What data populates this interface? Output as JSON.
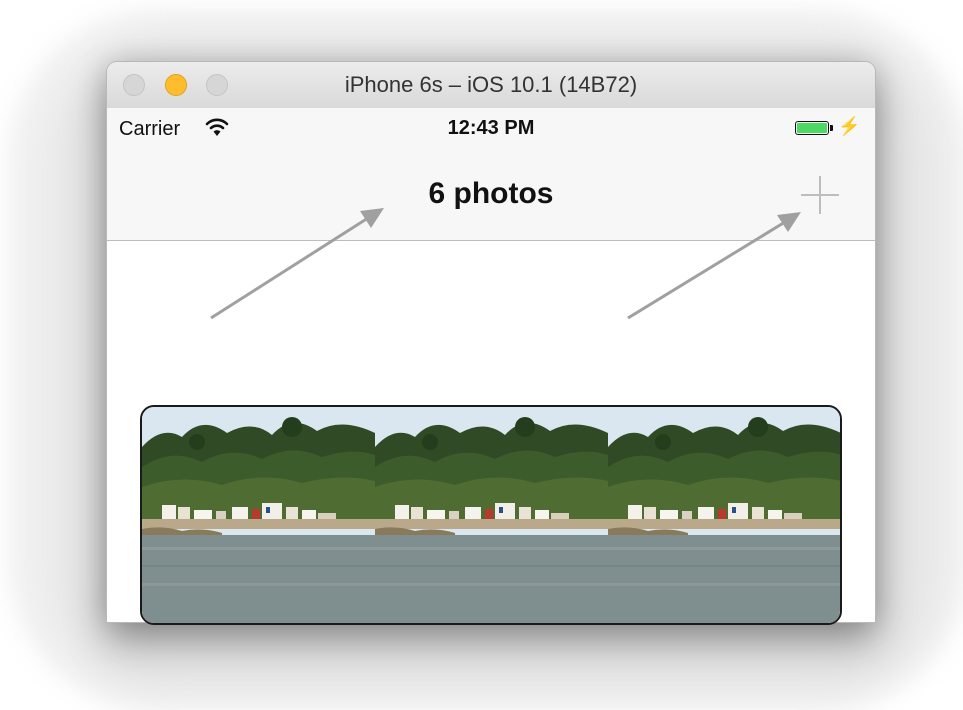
{
  "window": {
    "title": "iPhone 6s – iOS 10.1 (14B72)"
  },
  "status_bar": {
    "carrier": "Carrier",
    "time": "12:43 PM",
    "battery_level": 1.0
  },
  "nav_bar": {
    "title": "6 photos",
    "add_icon": "plus-icon"
  },
  "photos": {
    "visible_count": 3,
    "image_name": "coastal-village-icon"
  },
  "colors": {
    "accent": "#bdbdbd",
    "battery": "#4cd964",
    "arrow": "#a0a0a0",
    "minimize_light": "#ffbd2e"
  }
}
